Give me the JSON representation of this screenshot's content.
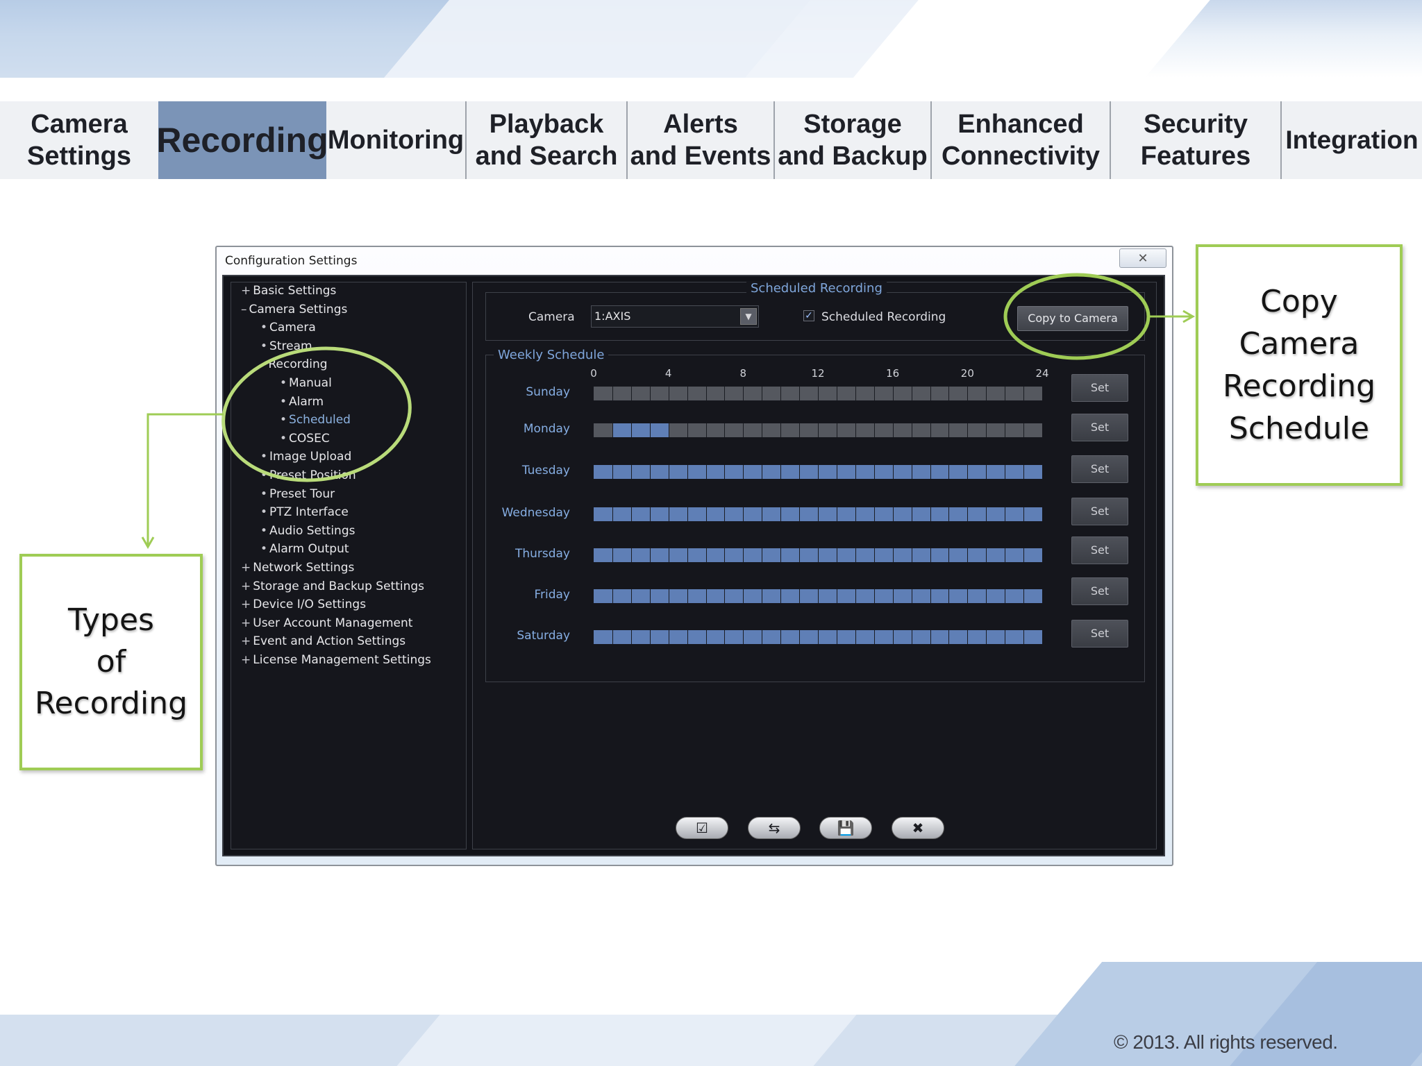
{
  "tabs": [
    {
      "label": "Camera\nSettings",
      "active": false
    },
    {
      "label": "Recording",
      "active": true
    },
    {
      "label": "Monitoring",
      "active": false
    },
    {
      "label": "Playback\nand Search",
      "active": false
    },
    {
      "label": "Alerts\nand Events",
      "active": false
    },
    {
      "label": "Storage\nand Backup",
      "active": false
    },
    {
      "label": "Enhanced\nConnectivity",
      "active": false
    },
    {
      "label": "Security\nFeatures",
      "active": false
    },
    {
      "label": "Integration",
      "active": false
    }
  ],
  "window": {
    "title": "Configuration Settings",
    "close_icon": "close-icon"
  },
  "tree": [
    {
      "prefix": "+",
      "label": "Basic Settings",
      "level": 0,
      "selected": false
    },
    {
      "prefix": "–",
      "label": "Camera Settings",
      "level": 0,
      "selected": false
    },
    {
      "prefix": "•",
      "label": "Camera",
      "level": 1,
      "selected": false
    },
    {
      "prefix": "•",
      "label": "Stream",
      "level": 1,
      "selected": false
    },
    {
      "prefix": "–",
      "label": "Recording",
      "level": 1,
      "selected": false
    },
    {
      "prefix": "•",
      "label": "Manual",
      "level": 2,
      "selected": false
    },
    {
      "prefix": "•",
      "label": "Alarm",
      "level": 2,
      "selected": false
    },
    {
      "prefix": "•",
      "label": "Scheduled",
      "level": 2,
      "selected": true
    },
    {
      "prefix": "•",
      "label": "COSEC",
      "level": 2,
      "selected": false
    },
    {
      "prefix": "•",
      "label": "Image Upload",
      "level": 1,
      "selected": false
    },
    {
      "prefix": "•",
      "label": "Preset Position",
      "level": 1,
      "selected": false
    },
    {
      "prefix": "•",
      "label": "Preset Tour",
      "level": 1,
      "selected": false
    },
    {
      "prefix": "•",
      "label": "PTZ Interface",
      "level": 1,
      "selected": false
    },
    {
      "prefix": "•",
      "label": "Audio Settings",
      "level": 1,
      "selected": false
    },
    {
      "prefix": "•",
      "label": "Alarm Output",
      "level": 1,
      "selected": false
    },
    {
      "prefix": "+",
      "label": "Network Settings",
      "level": 0,
      "selected": false
    },
    {
      "prefix": "+",
      "label": "Storage and Backup Settings",
      "level": 0,
      "selected": false
    },
    {
      "prefix": "+",
      "label": "Device I/O Settings",
      "level": 0,
      "selected": false
    },
    {
      "prefix": "+",
      "label": "User Account Management",
      "level": 0,
      "selected": false
    },
    {
      "prefix": "+",
      "label": "Event and Action Settings",
      "level": 0,
      "selected": false
    },
    {
      "prefix": "+",
      "label": "License Management Settings",
      "level": 0,
      "selected": false
    }
  ],
  "panel": {
    "legend": "Scheduled Recording",
    "camera_label": "Camera",
    "camera_value": "1:AXIS",
    "scheduled_checkbox_label": "Scheduled Recording",
    "scheduled_checked": true,
    "copy_button": "Copy to Camera"
  },
  "weekly": {
    "legend": "Weekly Schedule",
    "hour_labels": [
      "0",
      "4",
      "8",
      "12",
      "16",
      "20",
      "24"
    ],
    "set_label": "Set",
    "days": [
      {
        "name": "Sunday",
        "recording_ranges": []
      },
      {
        "name": "Monday",
        "recording_ranges": [
          [
            1,
            4
          ]
        ]
      },
      {
        "name": "Tuesday",
        "recording_ranges": [
          [
            0,
            24
          ]
        ]
      },
      {
        "name": "Wednesday",
        "recording_ranges": [
          [
            0,
            24
          ]
        ]
      },
      {
        "name": "Thursday",
        "recording_ranges": [
          [
            0,
            24
          ]
        ]
      },
      {
        "name": "Friday",
        "recording_ranges": [
          [
            0,
            24
          ]
        ]
      },
      {
        "name": "Saturday",
        "recording_ranges": [
          [
            0,
            24
          ]
        ]
      }
    ]
  },
  "bottom_buttons": [
    {
      "name": "apply-icon",
      "glyph": "☑"
    },
    {
      "name": "refresh-icon",
      "glyph": "⇆"
    },
    {
      "name": "save-icon",
      "glyph": "💾"
    },
    {
      "name": "close-icon",
      "glyph": "✖"
    }
  ],
  "callouts": {
    "copy": "Copy\nCamera\nRecording\nSchedule",
    "types": "Types\nof\nRecording"
  },
  "copyright": "© 2013. All rights reserved.",
  "colors": {
    "accent_green": "#9fcc55",
    "recorded": "#5f7fb6",
    "unrecorded": "#55585f",
    "active_tab": "#7b94b7",
    "selected_tree": "#8cb2e0"
  }
}
